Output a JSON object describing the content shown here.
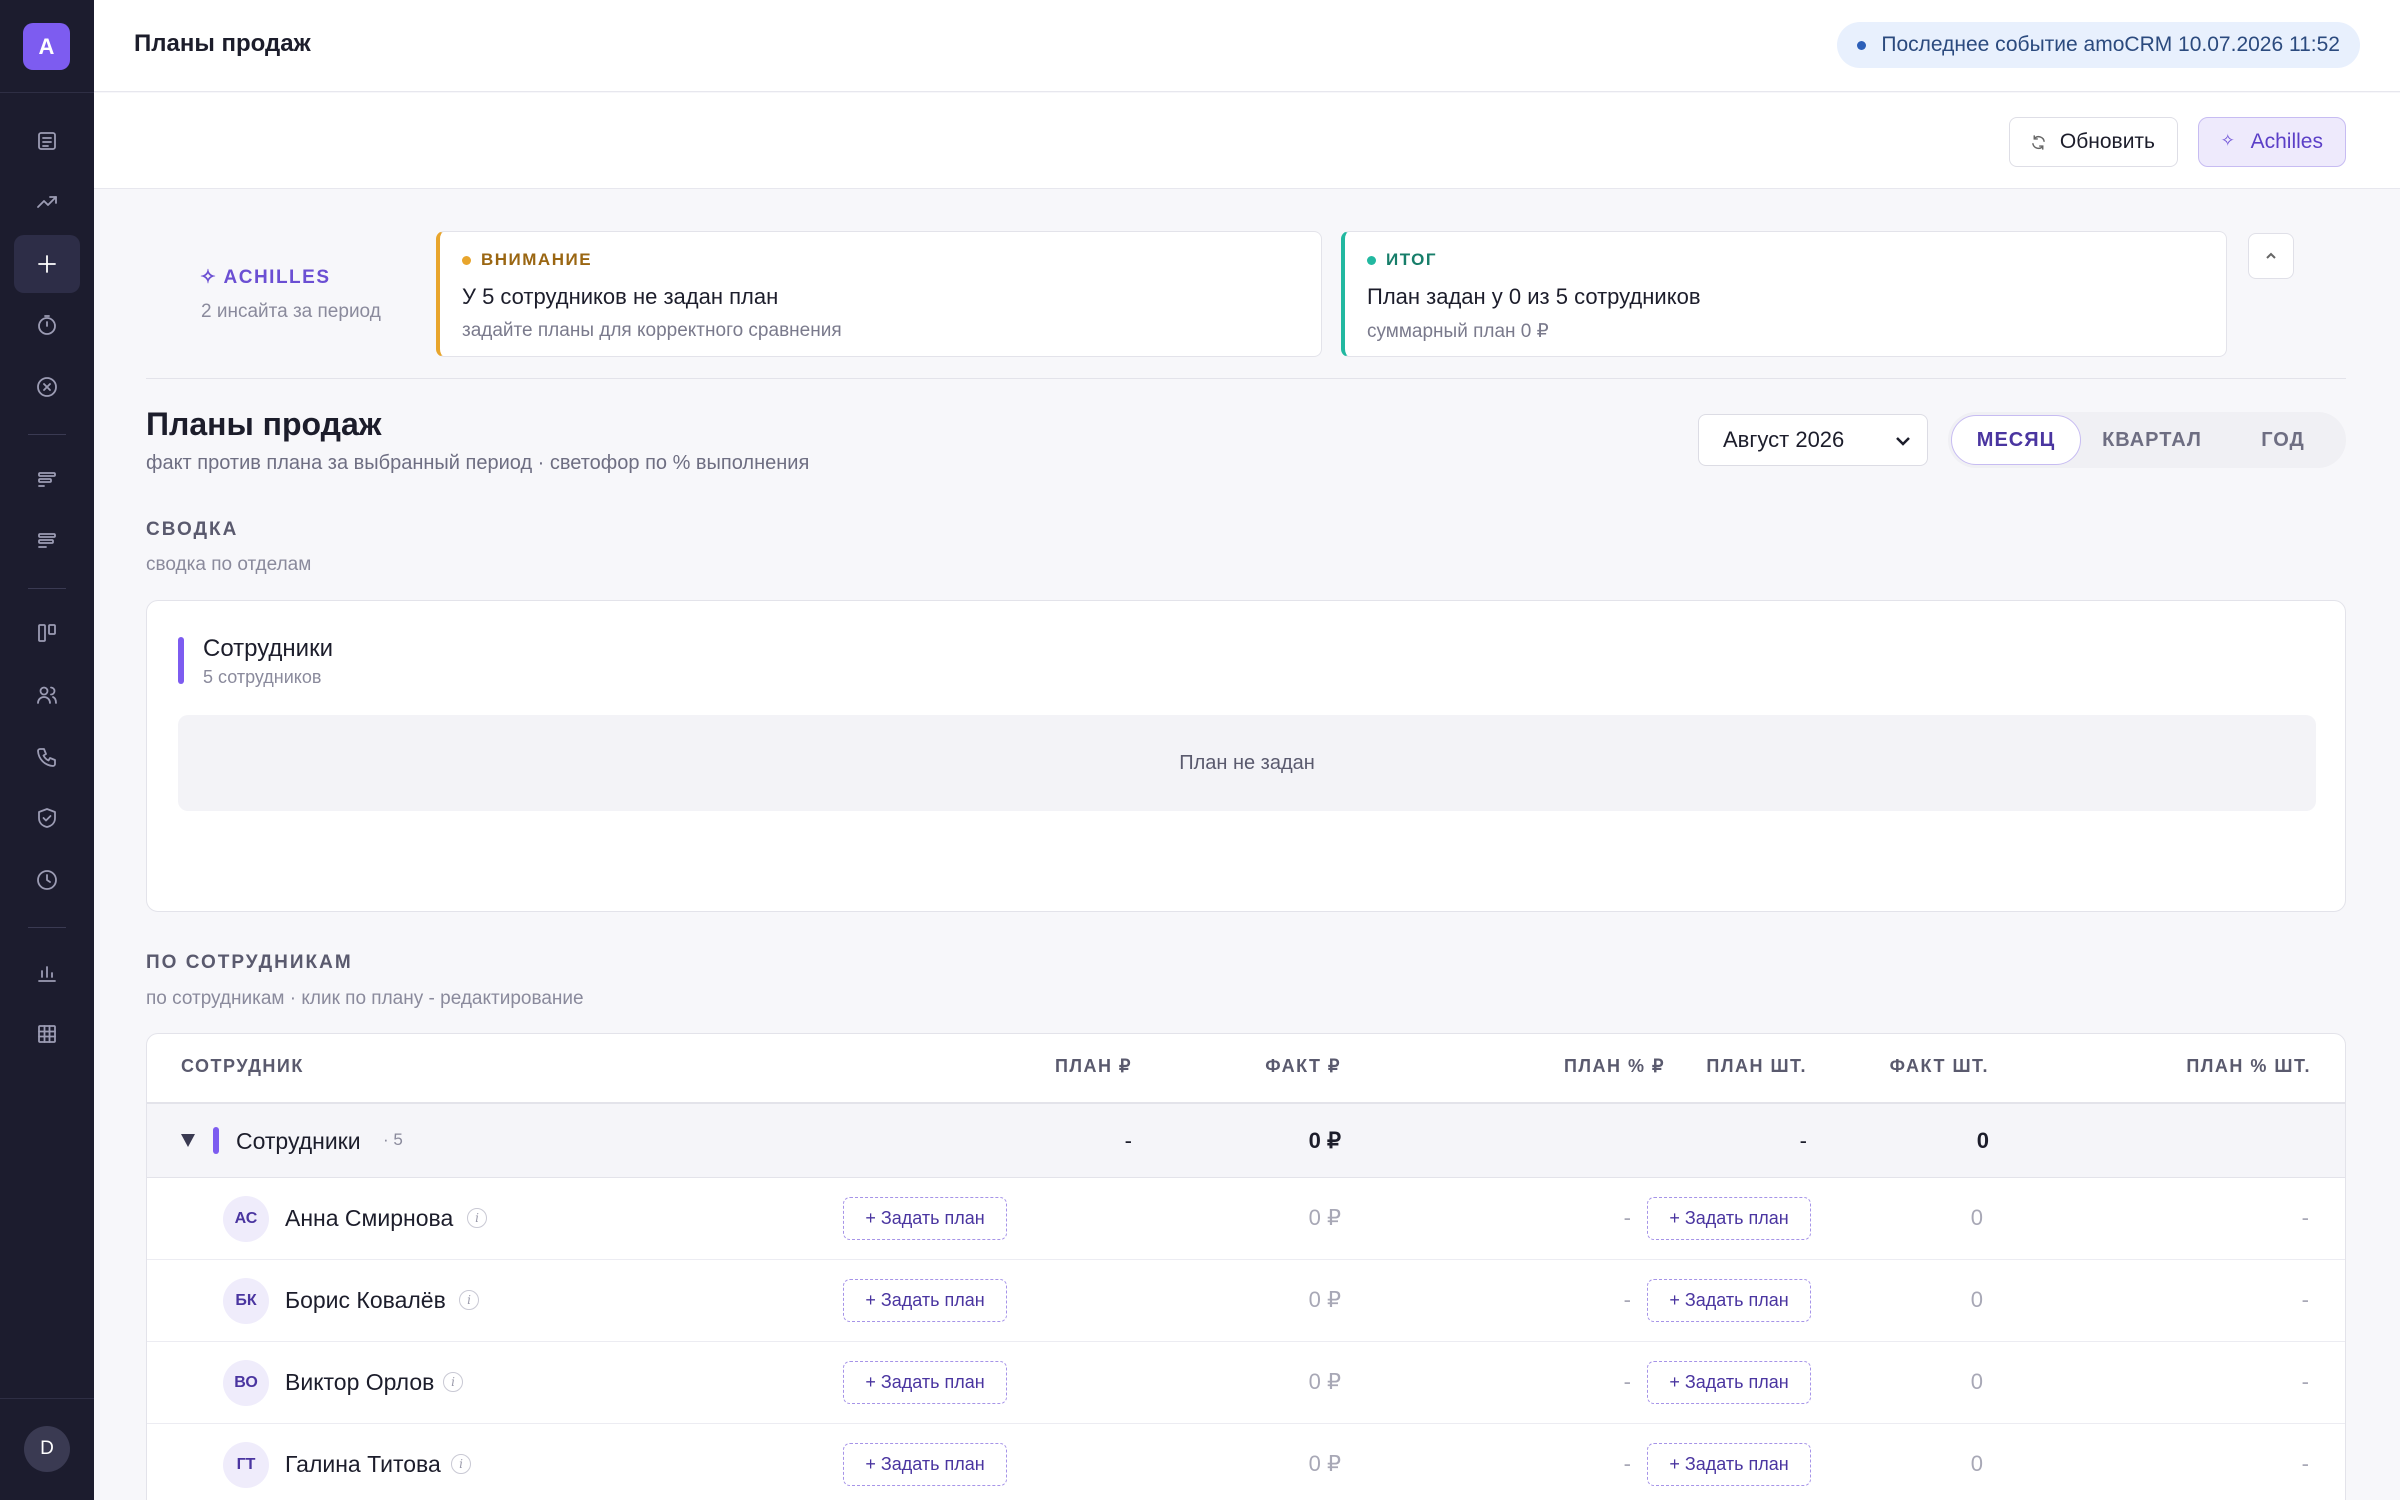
{
  "sidebar": {
    "logo": "A",
    "user_initial": "D",
    "icons": [
      "document-icon",
      "trend-up-icon",
      "plus-icon",
      "timer-icon",
      "cancel-circle-icon",
      "bars-left-icon",
      "bars-left-alt-icon",
      "kanban-icon",
      "users-icon",
      "phone-icon",
      "shield-check-icon",
      "clock-icon",
      "bar-chart-icon",
      "grid-icon"
    ]
  },
  "header": {
    "title": "Планы продаж",
    "event_badge": "Последнее событие amoCRM 10.07.2026 11:52"
  },
  "toolbar": {
    "refresh_label": "Обновить",
    "achilles_label": "Achilles"
  },
  "insights": {
    "label": "ACHILLES",
    "sublabel": "2 инсайта за период",
    "cards": [
      {
        "tag": "ВНИМАНИЕ",
        "title": "У 5 сотрудников не задан план",
        "subtitle": "задайте планы для корректного сравнения",
        "color": "#e8a52c"
      },
      {
        "tag": "ИТОГ",
        "title": "План задан у 0 из 5 сотрудников",
        "subtitle": "суммарный план 0 ₽",
        "color": "#22b8a0"
      }
    ]
  },
  "plans": {
    "title": "Планы продаж",
    "subtitle": "факт против плана за выбранный период · светофор по % выполнения",
    "period_value": "Август 2026",
    "segments": [
      "МЕСЯЦ",
      "КВАРТАЛ",
      "ГОД"
    ],
    "active_segment": "МЕСЯЦ"
  },
  "summary": {
    "label": "СВОДКА",
    "sublabel": "сводка по отделам",
    "dept_name": "Сотрудники",
    "dept_count": "5 сотрудников",
    "empty_text": "План не задан"
  },
  "by_employee": {
    "label": "ПО СОТРУДНИКАМ",
    "sublabel": "по сотрудникам · клик по плану - редактирование",
    "columns": [
      "СОТРУДНИК",
      "ПЛАН ₽",
      "ФАКТ ₽",
      "ПЛАН % ₽",
      "ПЛАН ШТ.",
      "ФАКТ ШТ.",
      "ПЛАН % ШТ."
    ],
    "group": {
      "name": "Сотрудники",
      "count": "· 5",
      "plan_rub": "-",
      "fact_rub": "0 ₽",
      "plan_pcs": "-",
      "fact_pcs": "0"
    },
    "set_plan_label": "+ Задать план",
    "rows": [
      {
        "initials": "АС",
        "name": "Анна Смирнова",
        "fact_rub": "0 ₽",
        "plan_pct_rub": "-",
        "fact_pcs": "0",
        "plan_pct_pcs": "-"
      },
      {
        "initials": "БК",
        "name": "Борис Ковалёв",
        "fact_rub": "0 ₽",
        "plan_pct_rub": "-",
        "fact_pcs": "0",
        "plan_pct_pcs": "-"
      },
      {
        "initials": "ВО",
        "name": "Виктор Орлов",
        "fact_rub": "0 ₽",
        "plan_pct_rub": "-",
        "fact_pcs": "0",
        "plan_pct_pcs": "-"
      },
      {
        "initials": "ГТ",
        "name": "Галина Титова",
        "fact_rub": "0 ₽",
        "plan_pct_rub": "-",
        "fact_pcs": "0",
        "plan_pct_pcs": "-"
      }
    ]
  }
}
